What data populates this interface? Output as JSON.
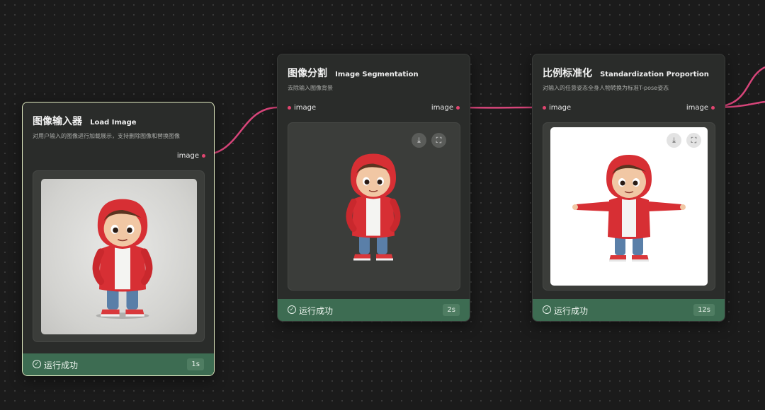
{
  "colors": {
    "wire": "#d8457a",
    "status_ok": "#3d6c52",
    "node_bg": "#2a2c2a"
  },
  "nodes": [
    {
      "title_zh": "图像输入器",
      "title_en": "Load Image",
      "description": "对用户输入的图像进行加载展示，支持删除图像和替换图像",
      "output_port": "image",
      "status_icon": "check-circle-icon",
      "status_text": "运行成功",
      "time": "1s"
    },
    {
      "title_zh": "图像分割",
      "title_en": "Image Segmentation",
      "description": "去除输入图像背景",
      "input_port": "image",
      "output_port": "image",
      "tools": [
        "download-icon",
        "fullscreen-icon"
      ],
      "status_icon": "check-circle-icon",
      "status_text": "运行成功",
      "time": "2s"
    },
    {
      "title_zh": "比例标准化",
      "title_en": "Standardization Proportion",
      "description": "对输入的任意姿态全身人物转换为标准T-pose姿态",
      "input_port": "image",
      "output_port": "image",
      "tools": [
        "download-icon",
        "fullscreen-icon"
      ],
      "status_icon": "check-circle-icon",
      "status_text": "运行成功",
      "time": "12s"
    }
  ]
}
